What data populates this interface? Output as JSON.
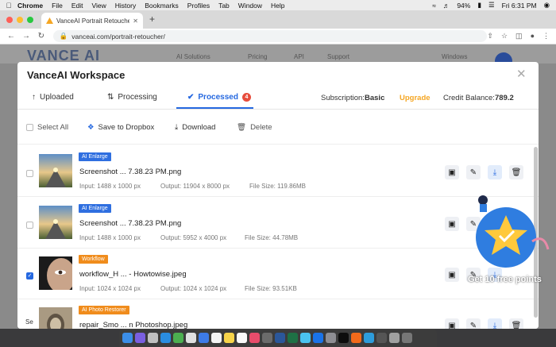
{
  "menubar": {
    "app": "Chrome",
    "items": [
      "File",
      "Edit",
      "View",
      "History",
      "Bookmarks",
      "Profiles",
      "Tab",
      "Window",
      "Help"
    ],
    "battery": "94%",
    "clock": "Fri 6:31 PM"
  },
  "browser": {
    "tab_title": "VanceAI Portrait Retoucher | R",
    "url": "vanceai.com/portrait-retoucher/"
  },
  "site": {
    "logo": "VANCE AI",
    "nav": [
      "AI Solutions",
      "Pricing",
      "API",
      "Support"
    ],
    "lang": "Windows"
  },
  "modal": {
    "title": "VanceAI Workspace",
    "tabs": [
      {
        "label": "Uploaded"
      },
      {
        "label": "Processing"
      },
      {
        "label": "Processed",
        "count": "4"
      }
    ],
    "subscription_label": "Subscription:",
    "subscription_value": "Basic",
    "upgrade": "Upgrade",
    "credit_label": "Credit Balance:",
    "credit_value": "789.2",
    "toolbar": {
      "select_all": "Select All",
      "save_dropbox": "Save to Dropbox",
      "download": "Download",
      "delete": "Delete"
    },
    "rows": [
      {
        "tag": "AI Enlarge",
        "tag_color": "#2f6fe0",
        "name": "Screenshot ... 7.38.23 PM.png",
        "input": "Input: 1488 x 1000 px",
        "output": "Output: 11904 x 8000 px",
        "size": "File Size: 119.86MB",
        "checked": false
      },
      {
        "tag": "AI Enlarge",
        "tag_color": "#2f6fe0",
        "name": "Screenshot ... 7.38.23 PM.png",
        "input": "Input: 1488 x 1000 px",
        "output": "Output: 5952 x 4000 px",
        "size": "File Size: 44.78MB",
        "checked": false
      },
      {
        "tag": "Workflow",
        "tag_color": "#f08c1c",
        "name": "workflow_H ... - Howtowise.jpeg",
        "input": "Input: 1024 x 1024 px",
        "output": "Output: 1024 x 1024 px",
        "size": "File Size: 93.51KB",
        "checked": true
      },
      {
        "tag": "AI Photo Restorer",
        "tag_color": "#f08c1c",
        "name": "repair_Smo ... n Photoshop.jpeg",
        "input": "",
        "output": "",
        "size": "",
        "checked": false
      }
    ]
  },
  "promo": {
    "text": "Get 10 free points"
  },
  "sidebar_hint": "Se"
}
